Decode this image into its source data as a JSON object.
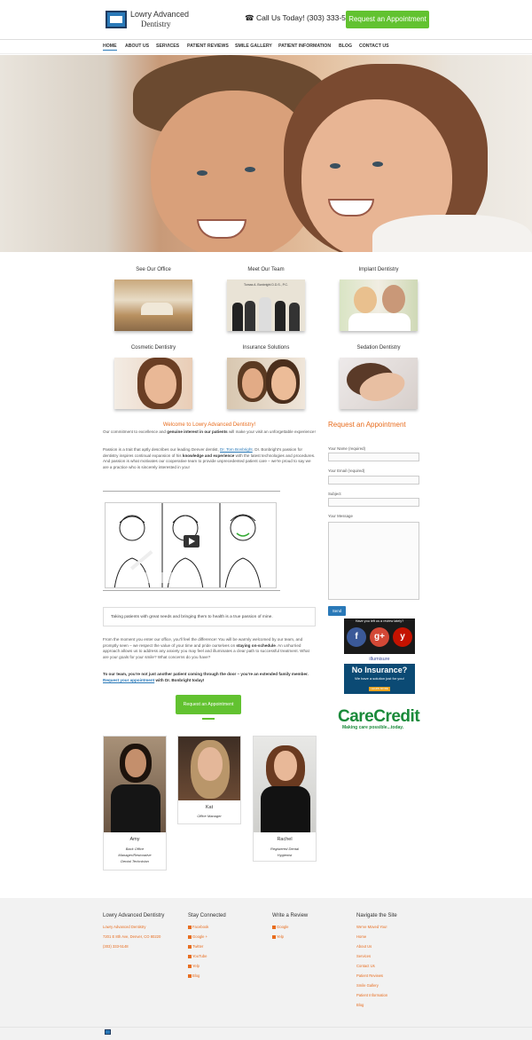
{
  "header": {
    "logo_line1": "Lowry Advanced",
    "logo_line2": "Dentistry",
    "phone": "☎ Call Us Today! (303) 333-5148",
    "cta": "Request an Appointment"
  },
  "nav": [
    "HOME",
    "ABOUT US",
    "SERVICES",
    "PATIENT REVIEWS",
    "SMILE GALLERY",
    "PATIENT INFORMATION",
    "BLOG",
    "CONTACT US"
  ],
  "tiles": [
    "See Our Office",
    "Meet Our Team",
    "Implant Dentistry",
    "Cosmetic Dentistry",
    "Insurance Solutions",
    "Sedation Dentistry"
  ],
  "team_sign": "Tomas A. Bonbright D.D.S., P.C.",
  "main": {
    "welcome": "Welcome to Lowry Advanced Dentistry!",
    "p1_a": "Our commitment to excellence and ",
    "p1_b": "genuine interest in our patients",
    "p1_c": " will make your visit an unforgettable experience!",
    "p2_a": "Passion is a trait that aptly describes our leading Denver dentist, ",
    "p2_link": "Dr. Tom Bonbright",
    "p2_b": ". Dr. Bonbright's passion for dentistry inspires continual expansion of his ",
    "p2_bold": "knowledge and experience",
    "p2_c": " with the latest technologies and procedures. And passion is what motivates our cooperative team to provide unprecedented patient care – we're proud to say we are a practice who is sincerely interested in you!",
    "quote": "Taking patients with great needs and bringing them to health is a true passion of mine.",
    "p3_a": "From the moment you enter our office, you'll feel the difference! You will be warmly welcomed by our team, and promptly seen – we respect the value of your time and pride ourselves on ",
    "p3_bold": "staying on-schedule",
    "p3_b": ". An unhurried approach allows us to address any anxiety you may feel and illuminates a clear path to successful treatment. What are your goals for your smile? What concerns do you have?",
    "p4_bold": "To our team, you're not just another patient coming through the door – you're an extended family member.",
    "p4_link": "Request your appointment",
    "p4_bold2": " with Dr. Bonbright today!",
    "cta": "Request an Appointment"
  },
  "form": {
    "title": "Request an Appointment",
    "name_label": "Your Name (required)",
    "email_label": "Your Email (required)",
    "subject_label": "Subject",
    "message_label": "Your Message",
    "send": "Send"
  },
  "sidebar": {
    "review_title": "Have you left us a review lately?",
    "illumisure": "illumisure",
    "no_insurance": "No Insurance?",
    "no_ins_sub": "We have a solution just for you!",
    "learn_more": "LEARN MORE",
    "carecredit": "CareCredit",
    "carecredit_tag": "Making care possible...today."
  },
  "team": [
    {
      "name": "Amy",
      "role1": "Back Office",
      "role2": "Manager/Restorative",
      "role3": "Dental Technician"
    },
    {
      "name": "Kat",
      "role1": "Office Manager"
    },
    {
      "name": "Rachel",
      "role1": "Registered Dental",
      "role2": "Hygienist"
    }
  ],
  "footer": {
    "col1_title": "Lowry Advanced Dentistry",
    "col1_lines": [
      "Lowry Advanced Dentistry",
      "7201 E 8th Ave, Denver, CO 80220",
      "(303) 333-5148"
    ],
    "col2_title": "Stay Connected",
    "col2_links": [
      "Facebook",
      "Google +",
      "Twitter",
      "YouTube",
      "Yelp",
      "Blog"
    ],
    "col3_title": "Write a Review",
    "col3_links": [
      "Google",
      "Yelp"
    ],
    "col4_title": "Navigate the Site",
    "col4_links": [
      "We've Moved You!",
      "Home",
      "About Us",
      "Services",
      "Contact Us",
      "Patient Reviews",
      "Smile Gallery",
      "Patient Information",
      "Blog"
    ]
  },
  "colors": {
    "accent_orange": "#e86d1f",
    "cta_green": "#62c230",
    "brand_blue": "#2a79b8"
  }
}
